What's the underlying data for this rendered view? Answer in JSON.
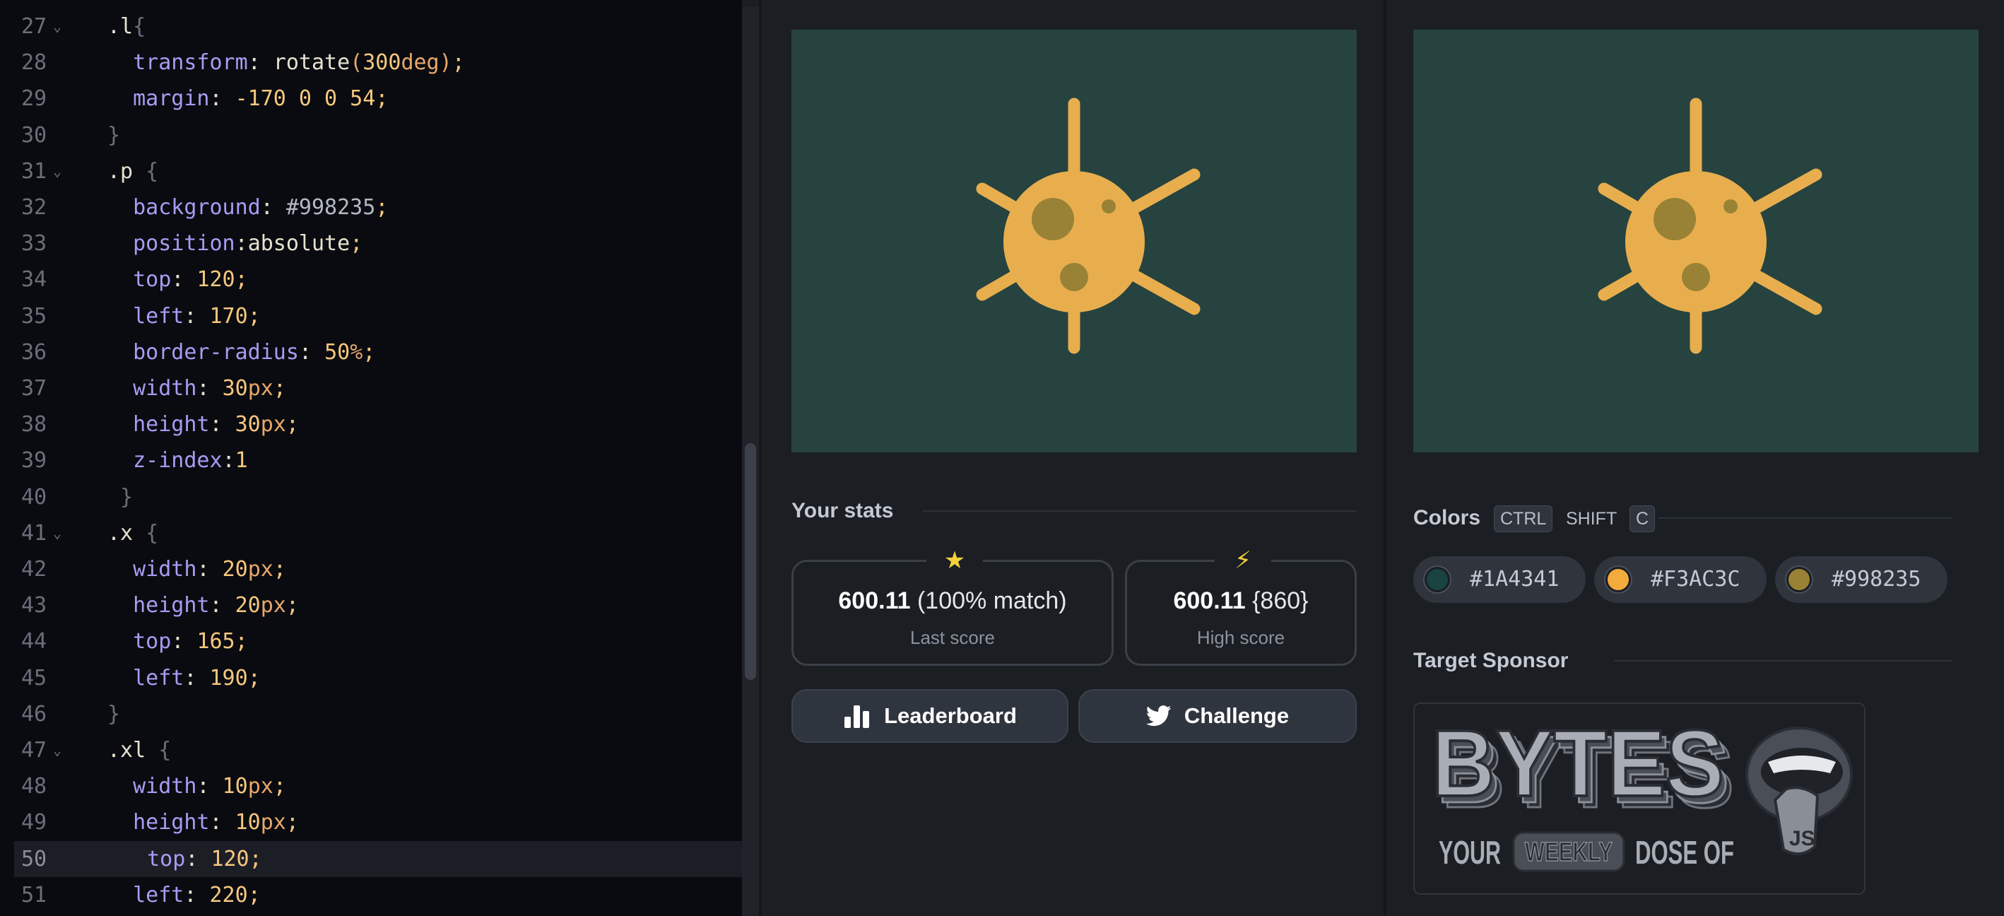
{
  "editor": {
    "lines": [
      {
        "n": "27",
        "fold": true,
        "tokens": [
          [
            ".l",
            "sel"
          ],
          [
            "{",
            "brace"
          ]
        ]
      },
      {
        "n": "28",
        "fold": false,
        "tokens": [
          [
            "  transform",
            "prop"
          ],
          [
            ": ",
            "punct"
          ],
          [
            "rotate",
            "fn"
          ],
          [
            "(",
            "paren"
          ],
          [
            "300",
            "num"
          ],
          [
            "deg",
            "unit"
          ],
          [
            ")",
            "paren"
          ],
          [
            ";",
            "semi"
          ]
        ]
      },
      {
        "n": "29",
        "fold": false,
        "tokens": [
          [
            "  margin",
            "prop"
          ],
          [
            ": ",
            "punct"
          ],
          [
            "-170 0 0 54",
            "num"
          ],
          [
            ";",
            "semi"
          ]
        ]
      },
      {
        "n": "30",
        "fold": false,
        "tokens": [
          [
            "}",
            "brace"
          ]
        ]
      },
      {
        "n": "31",
        "fold": true,
        "tokens": [
          [
            ".p",
            "sel"
          ],
          [
            " {",
            "brace"
          ]
        ]
      },
      {
        "n": "32",
        "fold": false,
        "tokens": [
          [
            "  background",
            "prop"
          ],
          [
            ": ",
            "punct"
          ],
          [
            "#998235",
            "hex"
          ],
          [
            ";",
            "semi"
          ]
        ]
      },
      {
        "n": "33",
        "fold": false,
        "tokens": [
          [
            "  position",
            "prop"
          ],
          [
            ":",
            "punct"
          ],
          [
            "absolute",
            "val"
          ],
          [
            ";",
            "semi"
          ]
        ]
      },
      {
        "n": "34",
        "fold": false,
        "tokens": [
          [
            "  top",
            "prop"
          ],
          [
            ": ",
            "punct"
          ],
          [
            "120",
            "num"
          ],
          [
            ";",
            "semi"
          ]
        ]
      },
      {
        "n": "35",
        "fold": false,
        "tokens": [
          [
            "  left",
            "prop"
          ],
          [
            ": ",
            "punct"
          ],
          [
            "170",
            "num"
          ],
          [
            ";",
            "semi"
          ]
        ]
      },
      {
        "n": "36",
        "fold": false,
        "tokens": [
          [
            "  border-radius",
            "prop"
          ],
          [
            ": ",
            "punct"
          ],
          [
            "50",
            "num"
          ],
          [
            "%",
            "unit"
          ],
          [
            ";",
            "semi"
          ]
        ]
      },
      {
        "n": "37",
        "fold": false,
        "tokens": [
          [
            "  width",
            "prop"
          ],
          [
            ": ",
            "punct"
          ],
          [
            "30",
            "num"
          ],
          [
            "px",
            "unit"
          ],
          [
            ";",
            "semi"
          ]
        ]
      },
      {
        "n": "38",
        "fold": false,
        "tokens": [
          [
            "  height",
            "prop"
          ],
          [
            ": ",
            "punct"
          ],
          [
            "30",
            "num"
          ],
          [
            "px",
            "unit"
          ],
          [
            ";",
            "semi"
          ]
        ]
      },
      {
        "n": "39",
        "fold": false,
        "tokens": [
          [
            "  z-index",
            "prop"
          ],
          [
            ":",
            "punct"
          ],
          [
            "1",
            "num"
          ]
        ]
      },
      {
        "n": "40",
        "fold": false,
        "tokens": [
          [
            " }",
            "brace"
          ]
        ]
      },
      {
        "n": "41",
        "fold": true,
        "tokens": [
          [
            ".x",
            "sel"
          ],
          [
            " {",
            "brace"
          ]
        ]
      },
      {
        "n": "42",
        "fold": false,
        "tokens": [
          [
            "  width",
            "prop"
          ],
          [
            ": ",
            "punct"
          ],
          [
            "20",
            "num"
          ],
          [
            "px",
            "unit"
          ],
          [
            ";",
            "semi"
          ]
        ]
      },
      {
        "n": "43",
        "fold": false,
        "tokens": [
          [
            "  height",
            "prop"
          ],
          [
            ": ",
            "punct"
          ],
          [
            "20",
            "num"
          ],
          [
            "px",
            "unit"
          ],
          [
            ";",
            "semi"
          ]
        ]
      },
      {
        "n": "44",
        "fold": false,
        "tokens": [
          [
            "  top",
            "prop"
          ],
          [
            ": ",
            "punct"
          ],
          [
            "165",
            "num"
          ],
          [
            ";",
            "semi"
          ]
        ]
      },
      {
        "n": "45",
        "fold": false,
        "tokens": [
          [
            "  left",
            "prop"
          ],
          [
            ": ",
            "punct"
          ],
          [
            "190",
            "num"
          ],
          [
            ";",
            "semi"
          ]
        ]
      },
      {
        "n": "46",
        "fold": false,
        "tokens": [
          [
            "}",
            "brace"
          ]
        ]
      },
      {
        "n": "47",
        "fold": true,
        "tokens": [
          [
            ".xl",
            "sel"
          ],
          [
            " {",
            "brace"
          ]
        ]
      },
      {
        "n": "48",
        "fold": false,
        "tokens": [
          [
            "  width",
            "prop"
          ],
          [
            ": ",
            "punct"
          ],
          [
            "10",
            "num"
          ],
          [
            "px",
            "unit"
          ],
          [
            ";",
            "semi"
          ]
        ]
      },
      {
        "n": "49",
        "fold": false,
        "tokens": [
          [
            "  height",
            "prop"
          ],
          [
            ": ",
            "punct"
          ],
          [
            "10",
            "num"
          ],
          [
            "px",
            "unit"
          ],
          [
            ";",
            "semi"
          ]
        ]
      },
      {
        "n": "50",
        "fold": false,
        "active": true,
        "tokens": [
          [
            "  top",
            "prop"
          ],
          [
            ": ",
            "punct"
          ],
          [
            "120",
            "num"
          ],
          [
            ";",
            "semi"
          ]
        ]
      },
      {
        "n": "51",
        "fold": false,
        "tokens": [
          [
            "  left",
            "prop"
          ],
          [
            ": ",
            "punct"
          ],
          [
            "220",
            "num"
          ],
          [
            ";",
            "semi"
          ]
        ]
      }
    ],
    "fold_glyph": "⌄",
    "scroll_position": 0.48,
    "scroll_visible_fraction": 0.26
  },
  "stats": {
    "title": "Your stats",
    "last_score_icon": "★",
    "last_score_value": "600.11",
    "last_score_detail": "(100% match)",
    "last_score_label": "Last score",
    "high_score_icon": "⚡",
    "high_score_value": "600.11",
    "high_score_detail": "{860}",
    "high_score_label": "High score",
    "leaderboard_label": "Leaderboard",
    "challenge_label": "Challenge"
  },
  "colors": {
    "title": "Colors",
    "shortcut": [
      "CTRL",
      "SHIFT",
      "C"
    ],
    "swatches": [
      {
        "hex": "#1A4341",
        "color": "#1A4341"
      },
      {
        "hex": "#F3AC3C",
        "color": "#F3AC3C"
      },
      {
        "hex": "#998235",
        "color": "#998235"
      }
    ]
  },
  "sponsor": {
    "title": "Target Sponsor",
    "logo_word": "BYTES",
    "tagline_1": "YOUR",
    "tagline_2": "WEEKLY",
    "tagline_3": "DOSE OF",
    "badge": "JS"
  },
  "target_colors": {
    "background": "#26433f",
    "virus": "#e8ae4e",
    "spot": "#998235"
  }
}
